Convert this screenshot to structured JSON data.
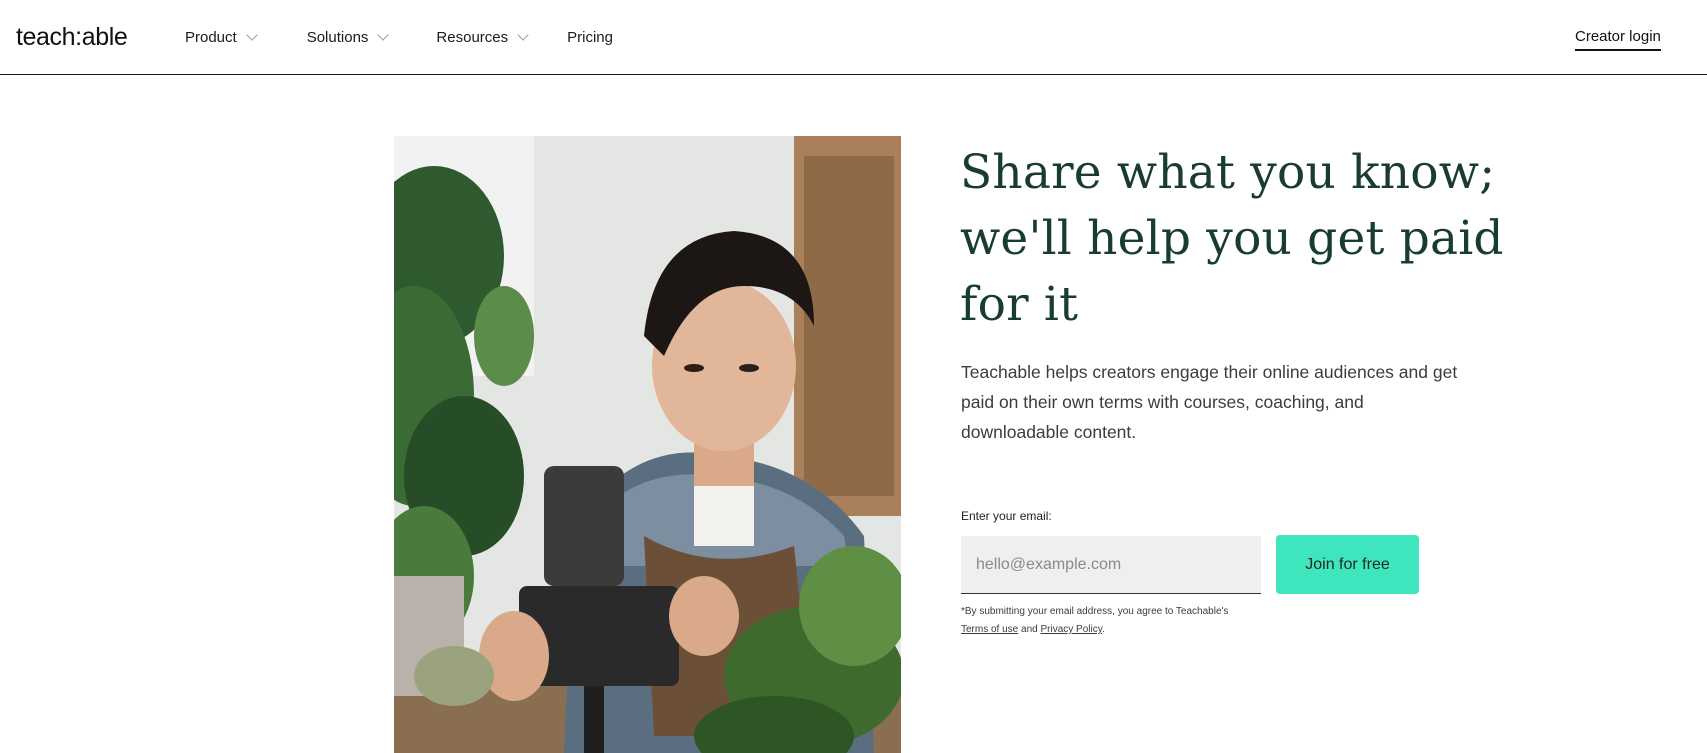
{
  "header": {
    "logo": "teach:able",
    "nav": [
      {
        "label": "Product",
        "has_dropdown": true
      },
      {
        "label": "Solutions",
        "has_dropdown": true
      },
      {
        "label": "Resources",
        "has_dropdown": true
      },
      {
        "label": "Pricing",
        "has_dropdown": false
      }
    ],
    "creator_login": "Creator login"
  },
  "hero": {
    "image_icon": "person-filming-plants-photo",
    "headline": "Share what you know; we'll help you get paid for it",
    "subtext": "Teachable helps creators engage their online audiences and get paid on their own terms with courses, coaching, and downloadable content.",
    "email_label": "Enter your email:",
    "email_placeholder": "hello@example.com",
    "email_value": "",
    "join_button": "Join for free",
    "disclaimer_prefix": "*By submitting your email address, you agree to Teachable's ",
    "terms_link": "Terms of use",
    "disclaimer_and": " and ",
    "privacy_link": "Privacy Policy",
    "disclaimer_suffix": "."
  },
  "colors": {
    "accent": "#3fe6bd",
    "headline": "#183c34",
    "input_bg": "#efefef"
  }
}
